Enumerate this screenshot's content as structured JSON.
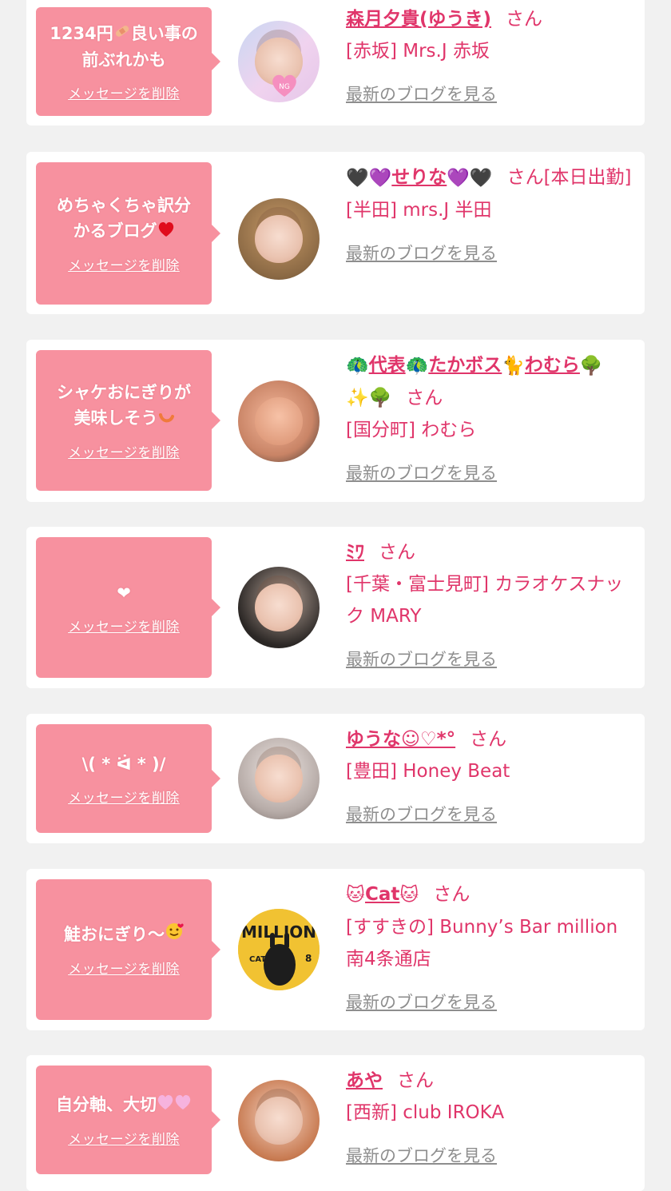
{
  "delete_label": "メッセージを削除",
  "blog_label": "最新のブログを見る",
  "san_label": "さん",
  "colors": {
    "bubble": "#f7919f",
    "accent": "#e0356a",
    "muted": "#8e8e8e",
    "card": "#ffffff",
    "background": "#f1f1f1"
  },
  "items": [
    {
      "message_lines": [
        "1234円",
        "良い事の",
        "前ぶれかも"
      ],
      "message_icon": "bandage-icon",
      "name": "森月夕貴(ゆうき)",
      "san_suffix": "",
      "shop": "[赤坂] Mrs.J 赤坂",
      "avatar": "girl-photo-pastel"
    },
    {
      "message_lines": [
        "めちゃくちゃ訳分",
        "かるブログ"
      ],
      "message_icon": "red-heart-icon",
      "name": "せりな",
      "name_icons": [
        "black-heart-icon",
        "purple-heart-icon"
      ],
      "san_suffix": "[本日出勤]",
      "shop": "[半田] mrs.J 半田",
      "avatar": "girl-photo-blonde"
    },
    {
      "message_lines": [
        "シャケおにぎりが",
        "美味しそう"
      ],
      "message_icon": "shrimp-icon",
      "name_parts": [
        "代表",
        "たかボス",
        "わむら"
      ],
      "name_icons": [
        "peacock-icon",
        "cat-icon",
        "tree-icon",
        "sparkles-icon"
      ],
      "san_suffix": "",
      "shop": "[国分町] わむら",
      "avatar": "bald-man-photo"
    },
    {
      "message_lines": [
        "❤"
      ],
      "message_icon": "",
      "name": "ﾐﾜ",
      "san_suffix": "",
      "shop": "[千葉・富士見町] カラオケスナック MARY",
      "avatar": "girl-photo-dark"
    },
    {
      "message_lines": [
        "\\( * ᐛ * )/"
      ],
      "message_icon": "",
      "name": "ゆうな☺♡*°",
      "san_suffix": "",
      "shop": "[豊田] Honey Beat",
      "avatar": "girl-photo-grey"
    },
    {
      "message_lines": [
        "鮭おにぎり〜"
      ],
      "message_icon": "smiling-hearts-icon",
      "name": "Cat",
      "name_icons": [
        "cat-face-icon"
      ],
      "san_suffix": "",
      "shop": "[すすきの] Bunny’s Bar million 南4条通店",
      "avatar": "million-cover-photo"
    },
    {
      "message_lines": [
        "自分軸、大切"
      ],
      "message_icon": "pink-hearts-icon",
      "name": "あや",
      "san_suffix": "",
      "shop": "[西新] club IROKA",
      "avatar": "girl-photo-redhair"
    }
  ]
}
